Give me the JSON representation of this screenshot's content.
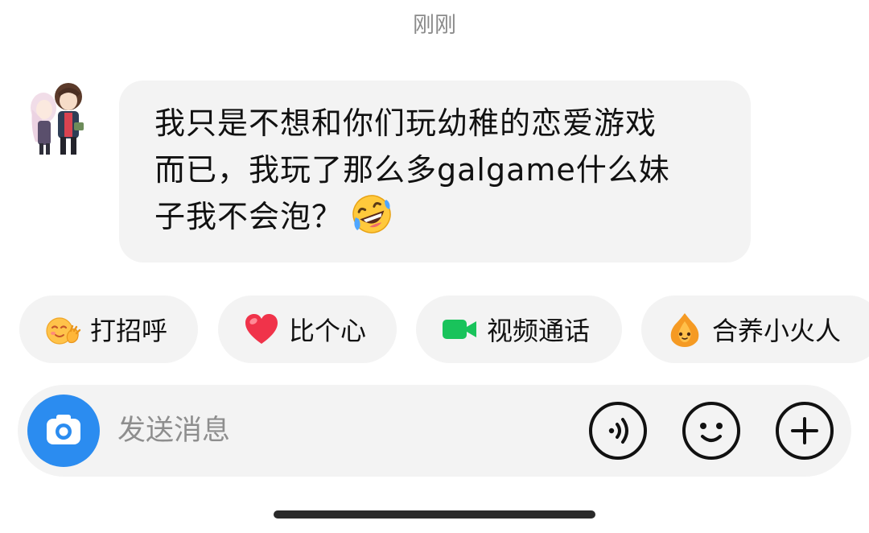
{
  "conversation": {
    "timestamp": "刚刚",
    "message": {
      "lines": [
        "我只是不想和你们玩幼稚的恋爱游戏",
        "而已，我玩了那么多galgame什么妹",
        "子我不会泡？"
      ],
      "trailing_emoji": "rolling-on-floor-laughing-emoji"
    }
  },
  "quick_actions": [
    {
      "label": "打招呼",
      "icon": "waving-face-icon"
    },
    {
      "label": "比个心",
      "icon": "heart-icon"
    },
    {
      "label": "视频通话",
      "icon": "video-camera-icon"
    },
    {
      "label": "合养小火人",
      "icon": "little-fire-icon"
    }
  ],
  "composer": {
    "placeholder": "发送消息",
    "value": "",
    "buttons": [
      "camera-icon",
      "voice-icon",
      "emoji-icon",
      "plus-icon"
    ]
  },
  "colors": {
    "accent_blue": "#2b8cf0",
    "bubble_bg": "#f3f3f3",
    "heart_red": "#f0334a",
    "video_green": "#19c35b",
    "fire_orange": "#f59a23",
    "timestamp_gray": "#8a8a8a"
  }
}
